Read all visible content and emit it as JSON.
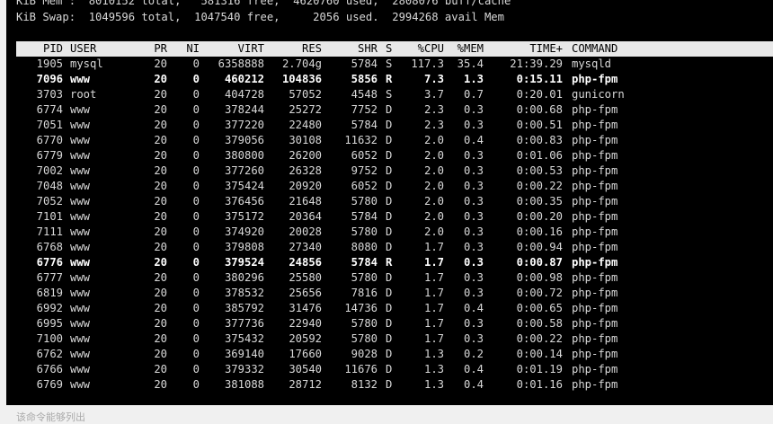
{
  "summary": {
    "mem_line": "KiB Mem :  8010152 total,   581316 free,  4620760 used,  2808076 buff/cache",
    "swap_line": "KiB Swap:  1049596 total,  1047540 free,     2056 used.  2994268 avail Mem"
  },
  "columns": {
    "pid": "PID",
    "user": "USER",
    "pr": "PR",
    "ni": "NI",
    "virt": "VIRT",
    "res": "RES",
    "shr": "SHR",
    "s": "S",
    "cpu": "%CPU",
    "mem": "%MEM",
    "time": "TIME+",
    "command": "COMMAND"
  },
  "processes": [
    {
      "pid": "1905",
      "user": "mysql",
      "pr": "20",
      "ni": "0",
      "virt": "6358888",
      "res": "2.704g",
      "shr": "5784",
      "s": "S",
      "cpu": "117.3",
      "mem": "35.4",
      "time": "21:39.29",
      "command": "mysqld",
      "bold": false
    },
    {
      "pid": "7096",
      "user": "www",
      "pr": "20",
      "ni": "0",
      "virt": "460212",
      "res": "104836",
      "shr": "5856",
      "s": "R",
      "cpu": "7.3",
      "mem": "1.3",
      "time": "0:15.11",
      "command": "php-fpm",
      "bold": true
    },
    {
      "pid": "3703",
      "user": "root",
      "pr": "20",
      "ni": "0",
      "virt": "404728",
      "res": "57052",
      "shr": "4548",
      "s": "S",
      "cpu": "3.7",
      "mem": "0.7",
      "time": "0:20.01",
      "command": "gunicorn",
      "bold": false
    },
    {
      "pid": "6774",
      "user": "www",
      "pr": "20",
      "ni": "0",
      "virt": "378244",
      "res": "25272",
      "shr": "7752",
      "s": "D",
      "cpu": "2.3",
      "mem": "0.3",
      "time": "0:00.68",
      "command": "php-fpm",
      "bold": false
    },
    {
      "pid": "7051",
      "user": "www",
      "pr": "20",
      "ni": "0",
      "virt": "377220",
      "res": "22480",
      "shr": "5784",
      "s": "D",
      "cpu": "2.3",
      "mem": "0.3",
      "time": "0:00.51",
      "command": "php-fpm",
      "bold": false
    },
    {
      "pid": "6770",
      "user": "www",
      "pr": "20",
      "ni": "0",
      "virt": "379056",
      "res": "30108",
      "shr": "11632",
      "s": "D",
      "cpu": "2.0",
      "mem": "0.4",
      "time": "0:00.83",
      "command": "php-fpm",
      "bold": false
    },
    {
      "pid": "6779",
      "user": "www",
      "pr": "20",
      "ni": "0",
      "virt": "380800",
      "res": "26200",
      "shr": "6052",
      "s": "D",
      "cpu": "2.0",
      "mem": "0.3",
      "time": "0:01.06",
      "command": "php-fpm",
      "bold": false
    },
    {
      "pid": "7002",
      "user": "www",
      "pr": "20",
      "ni": "0",
      "virt": "377260",
      "res": "26328",
      "shr": "9752",
      "s": "D",
      "cpu": "2.0",
      "mem": "0.3",
      "time": "0:00.53",
      "command": "php-fpm",
      "bold": false
    },
    {
      "pid": "7048",
      "user": "www",
      "pr": "20",
      "ni": "0",
      "virt": "375424",
      "res": "20920",
      "shr": "6052",
      "s": "D",
      "cpu": "2.0",
      "mem": "0.3",
      "time": "0:00.22",
      "command": "php-fpm",
      "bold": false
    },
    {
      "pid": "7052",
      "user": "www",
      "pr": "20",
      "ni": "0",
      "virt": "376456",
      "res": "21648",
      "shr": "5780",
      "s": "D",
      "cpu": "2.0",
      "mem": "0.3",
      "time": "0:00.35",
      "command": "php-fpm",
      "bold": false
    },
    {
      "pid": "7101",
      "user": "www",
      "pr": "20",
      "ni": "0",
      "virt": "375172",
      "res": "20364",
      "shr": "5784",
      "s": "D",
      "cpu": "2.0",
      "mem": "0.3",
      "time": "0:00.20",
      "command": "php-fpm",
      "bold": false
    },
    {
      "pid": "7111",
      "user": "www",
      "pr": "20",
      "ni": "0",
      "virt": "374920",
      "res": "20028",
      "shr": "5780",
      "s": "D",
      "cpu": "2.0",
      "mem": "0.3",
      "time": "0:00.16",
      "command": "php-fpm",
      "bold": false
    },
    {
      "pid": "6768",
      "user": "www",
      "pr": "20",
      "ni": "0",
      "virt": "379808",
      "res": "27340",
      "shr": "8080",
      "s": "D",
      "cpu": "1.7",
      "mem": "0.3",
      "time": "0:00.94",
      "command": "php-fpm",
      "bold": false
    },
    {
      "pid": "6776",
      "user": "www",
      "pr": "20",
      "ni": "0",
      "virt": "379524",
      "res": "24856",
      "shr": "5784",
      "s": "R",
      "cpu": "1.7",
      "mem": "0.3",
      "time": "0:00.87",
      "command": "php-fpm",
      "bold": true
    },
    {
      "pid": "6777",
      "user": "www",
      "pr": "20",
      "ni": "0",
      "virt": "380296",
      "res": "25580",
      "shr": "5780",
      "s": "D",
      "cpu": "1.7",
      "mem": "0.3",
      "time": "0:00.98",
      "command": "php-fpm",
      "bold": false
    },
    {
      "pid": "6819",
      "user": "www",
      "pr": "20",
      "ni": "0",
      "virt": "378532",
      "res": "25656",
      "shr": "7816",
      "s": "D",
      "cpu": "1.7",
      "mem": "0.3",
      "time": "0:00.72",
      "command": "php-fpm",
      "bold": false
    },
    {
      "pid": "6992",
      "user": "www",
      "pr": "20",
      "ni": "0",
      "virt": "385792",
      "res": "31476",
      "shr": "14736",
      "s": "D",
      "cpu": "1.7",
      "mem": "0.4",
      "time": "0:00.65",
      "command": "php-fpm",
      "bold": false
    },
    {
      "pid": "6995",
      "user": "www",
      "pr": "20",
      "ni": "0",
      "virt": "377736",
      "res": "22940",
      "shr": "5780",
      "s": "D",
      "cpu": "1.7",
      "mem": "0.3",
      "time": "0:00.58",
      "command": "php-fpm",
      "bold": false
    },
    {
      "pid": "7100",
      "user": "www",
      "pr": "20",
      "ni": "0",
      "virt": "375432",
      "res": "20592",
      "shr": "5780",
      "s": "D",
      "cpu": "1.7",
      "mem": "0.3",
      "time": "0:00.22",
      "command": "php-fpm",
      "bold": false
    },
    {
      "pid": "6762",
      "user": "www",
      "pr": "20",
      "ni": "0",
      "virt": "369140",
      "res": "17660",
      "shr": "9028",
      "s": "D",
      "cpu": "1.3",
      "mem": "0.2",
      "time": "0:00.14",
      "command": "php-fpm",
      "bold": false
    },
    {
      "pid": "6766",
      "user": "www",
      "pr": "20",
      "ni": "0",
      "virt": "379332",
      "res": "30540",
      "shr": "11676",
      "s": "D",
      "cpu": "1.3",
      "mem": "0.4",
      "time": "0:01.19",
      "command": "php-fpm",
      "bold": false
    },
    {
      "pid": "6769",
      "user": "www",
      "pr": "20",
      "ni": "0",
      "virt": "381088",
      "res": "28712",
      "shr": "8132",
      "s": "D",
      "cpu": "1.3",
      "mem": "0.4",
      "time": "0:01.16",
      "command": "php-fpm",
      "bold": false
    }
  ],
  "caption": "该命令能够列出"
}
